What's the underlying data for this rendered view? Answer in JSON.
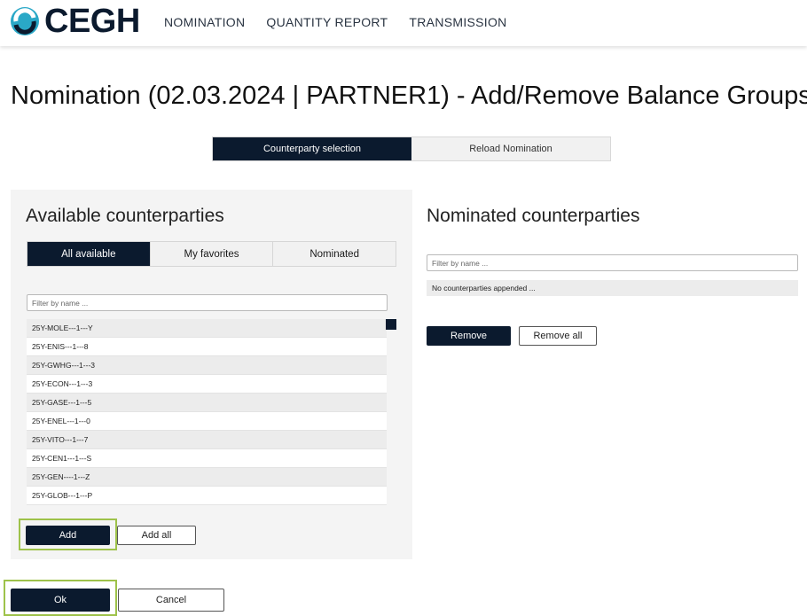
{
  "header": {
    "logo_text": "CEGH",
    "nav": [
      "NOMINATION",
      "QUANTITY REPORT",
      "TRANSMISSION"
    ],
    "brand_color": "#0b1a2e",
    "logo_accent": "#2aa8c7"
  },
  "page": {
    "title": "Nomination (02.03.2024 | PARTNER1) - Add/Remove Balance Groups"
  },
  "mode_tabs": {
    "counterparty_selection": "Counterparty selection",
    "reload_nomination": "Reload Nomination",
    "active": "Counterparty selection"
  },
  "available": {
    "title": "Available counterparties",
    "tabs": [
      "All available",
      "My favorites",
      "Nominated"
    ],
    "active_tab": "All available",
    "filter_placeholder": "Filter by name ...",
    "items": [
      "25Y-MOLE---1---Y",
      "25Y-ENIS---1---8",
      "25Y-GWHG---1---3",
      "25Y-ECON---1---3",
      "25Y-GASE---1---5",
      "25Y-ENEL---1---0",
      "25Y-VITO---1---7",
      "25Y-CEN1---1---S",
      "25Y-GEN----1---Z",
      "25Y-GLOB---1---P"
    ],
    "add_label": "Add",
    "add_all_label": "Add all"
  },
  "nominated": {
    "title": "Nominated counterparties",
    "filter_placeholder": "Filter by name ...",
    "empty_text": "No counterparties appended ...",
    "remove_label": "Remove",
    "remove_all_label": "Remove all"
  },
  "footer": {
    "ok_label": "Ok",
    "cancel_label": "Cancel"
  },
  "highlight_color": "#9ec24a"
}
